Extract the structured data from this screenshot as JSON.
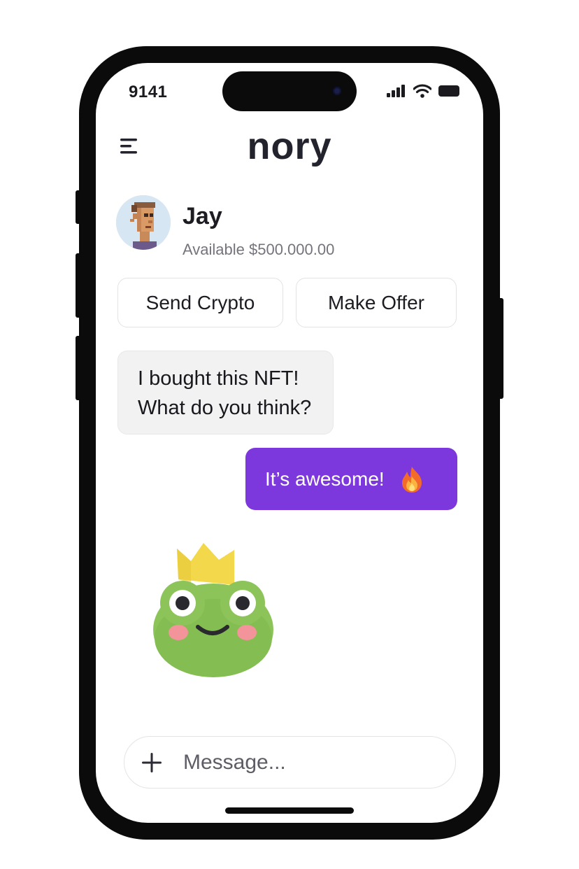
{
  "status_bar": {
    "time": "9141",
    "icons": [
      "cellular-signal-icon",
      "wifi-icon",
      "battery-icon"
    ]
  },
  "header": {
    "menu_icon": "hamburger-menu-icon",
    "title": "nory"
  },
  "contact": {
    "name": "Jay",
    "balance": "Available $500.000.00",
    "avatar": "pixel-art-nft-avatar"
  },
  "actions": {
    "send_label": "Send Crypto",
    "offer_label": "Make Offer"
  },
  "messages": {
    "incoming_lines": [
      "I bought this NFT!",
      "What do you think?"
    ],
    "outgoing_text": "It’s awesome!",
    "outgoing_emoji": "fire-icon",
    "sticker": "frog-prince-sticker"
  },
  "composer": {
    "plus_icon": "plus-icon",
    "placeholder": "Message..."
  },
  "colors": {
    "accent": "#7C38DD",
    "incoming_bubble": "#F2F2F3",
    "title": "#23232E",
    "frog_green": "#8CC45A",
    "crown_yellow": "#F2D84A"
  }
}
